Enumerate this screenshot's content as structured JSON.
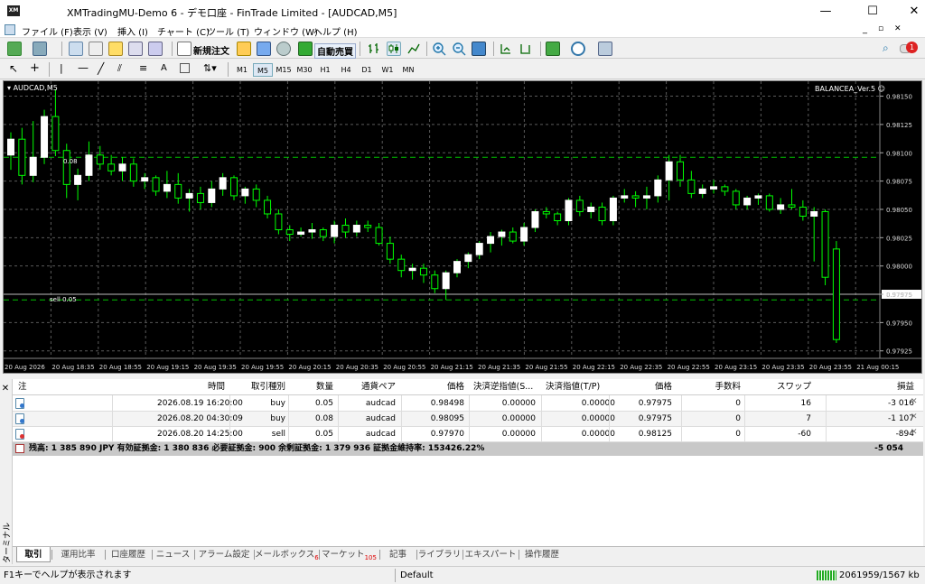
{
  "window": {
    "title": "XMTradingMU-Demo 6 - デモ口座 - FinTrade Limited - [AUDCAD,M5]",
    "logo": "XM",
    "minimize": "—",
    "maximize": "☐",
    "close": "✕"
  },
  "menu": [
    "ファイル (F)",
    "表示 (V)",
    "挿入 (I)",
    "チャート (C)",
    "ツール (T)",
    "ウィンドウ (W)",
    "ヘルプ (H)"
  ],
  "toolbar": {
    "new_order": "新規注文",
    "auto_trade": "自動売買",
    "notif_count": "1"
  },
  "timeframes": [
    "M1",
    "M5",
    "M15",
    "M30",
    "H1",
    "H4",
    "D1",
    "W1",
    "MN"
  ],
  "active_timeframe": "M5",
  "chart": {
    "symbol": "AUDCAD,M5",
    "ea": "BALANCEA_Ver.5 ☺",
    "price_labels": [
      "0.98150",
      "0.98125",
      "0.98100",
      "0.98075",
      "0.98050",
      "0.98025",
      "0.98000",
      "0.97975",
      "0.97950",
      "0.97925"
    ],
    "current_price": "0.97975",
    "time_labels": [
      "20 Aug 2026",
      "20 Aug 18:35",
      "20 Aug 18:55",
      "20 Aug 19:15",
      "20 Aug 19:35",
      "20 Aug 19:55",
      "20 Aug 20:15",
      "20 Aug 20:35",
      "20 Aug 20:55",
      "20 Aug 21:15",
      "20 Aug 21:35",
      "20 Aug 21:55",
      "20 Aug 22:15",
      "20 Aug 22:35",
      "20 Aug 22:55",
      "20 Aug 23:15",
      "20 Aug 23:35",
      "20 Aug 23:55",
      "21 Aug 00:15"
    ],
    "line_label_upper": "0.08",
    "line_label_sell": "sell 0.05",
    "colors": {
      "bull": "#ffffff",
      "bear": "#000000",
      "wick": "#00ff00",
      "grid": "#5a5a5a",
      "levels": "#00c000"
    }
  },
  "chart_data": {
    "type": "candlestick",
    "ylim": [
      0.9792,
      0.9816
    ],
    "candles": [
      [
        0.98098,
        0.98118,
        0.98085,
        0.98112
      ],
      [
        0.98112,
        0.98122,
        0.98072,
        0.9808
      ],
      [
        0.9808,
        0.98128,
        0.98074,
        0.98096
      ],
      [
        0.98096,
        0.98138,
        0.9809,
        0.98132
      ],
      [
        0.98132,
        0.98156,
        0.98097,
        0.98102
      ],
      [
        0.98102,
        0.98108,
        0.9806,
        0.98072
      ],
      [
        0.98072,
        0.98086,
        0.98058,
        0.9808
      ],
      [
        0.9808,
        0.9811,
        0.98075,
        0.98098
      ],
      [
        0.98098,
        0.98106,
        0.98085,
        0.9809
      ],
      [
        0.9809,
        0.98098,
        0.9808,
        0.98084
      ],
      [
        0.98084,
        0.98096,
        0.98075,
        0.9809
      ],
      [
        0.9809,
        0.98095,
        0.9807,
        0.98075
      ],
      [
        0.98075,
        0.98082,
        0.98068,
        0.98078
      ],
      [
        0.98078,
        0.9808,
        0.98062,
        0.98066
      ],
      [
        0.98066,
        0.98084,
        0.9806,
        0.98072
      ],
      [
        0.98072,
        0.98082,
        0.98055,
        0.9806
      ],
      [
        0.9806,
        0.98068,
        0.98048,
        0.98064
      ],
      [
        0.98064,
        0.9807,
        0.9805,
        0.98056
      ],
      [
        0.98056,
        0.98075,
        0.98052,
        0.98068
      ],
      [
        0.98068,
        0.98082,
        0.98062,
        0.98078
      ],
      [
        0.98078,
        0.9808,
        0.98058,
        0.98062
      ],
      [
        0.98062,
        0.9807,
        0.98055,
        0.98068
      ],
      [
        0.98068,
        0.98072,
        0.98052,
        0.98058
      ],
      [
        0.98058,
        0.98062,
        0.98042,
        0.98046
      ],
      [
        0.98046,
        0.9805,
        0.98028,
        0.98032
      ],
      [
        0.98032,
        0.98036,
        0.98022,
        0.98028
      ],
      [
        0.98028,
        0.98034,
        0.98026,
        0.9803
      ],
      [
        0.9803,
        0.98038,
        0.98024,
        0.98032
      ],
      [
        0.98032,
        0.98034,
        0.98022,
        0.98026
      ],
      [
        0.98026,
        0.9804,
        0.9802,
        0.98036
      ],
      [
        0.98036,
        0.98042,
        0.98025,
        0.9803
      ],
      [
        0.9803,
        0.9804,
        0.98026,
        0.98036
      ],
      [
        0.98036,
        0.9804,
        0.9803,
        0.98034
      ],
      [
        0.98034,
        0.98038,
        0.98018,
        0.9802
      ],
      [
        0.9802,
        0.98026,
        0.98002,
        0.98006
      ],
      [
        0.98006,
        0.9801,
        0.9799,
        0.97996
      ],
      [
        0.97996,
        0.98002,
        0.97988,
        0.97998
      ],
      [
        0.97998,
        0.98002,
        0.97985,
        0.97992
      ],
      [
        0.97992,
        0.97996,
        0.97976,
        0.9798
      ],
      [
        0.9798,
        0.97996,
        0.9797,
        0.97994
      ],
      [
        0.97994,
        0.98006,
        0.9799,
        0.98004
      ],
      [
        0.98004,
        0.98012,
        0.97998,
        0.9801
      ],
      [
        0.9801,
        0.98022,
        0.98006,
        0.9802
      ],
      [
        0.9802,
        0.9803,
        0.98012,
        0.98026
      ],
      [
        0.98026,
        0.98032,
        0.98018,
        0.9803
      ],
      [
        0.9803,
        0.98034,
        0.9802,
        0.98022
      ],
      [
        0.98022,
        0.98038,
        0.98018,
        0.98034
      ],
      [
        0.98034,
        0.9805,
        0.9803,
        0.98048
      ],
      [
        0.98048,
        0.98052,
        0.98042,
        0.98046
      ],
      [
        0.98046,
        0.98048,
        0.98036,
        0.9804
      ],
      [
        0.9804,
        0.9806,
        0.98036,
        0.98058
      ],
      [
        0.98058,
        0.98062,
        0.98044,
        0.98048
      ],
      [
        0.98048,
        0.98056,
        0.98042,
        0.98052
      ],
      [
        0.98052,
        0.98056,
        0.98036,
        0.9804
      ],
      [
        0.9804,
        0.98062,
        0.98036,
        0.9806
      ],
      [
        0.9806,
        0.98068,
        0.98056,
        0.98062
      ],
      [
        0.98062,
        0.98066,
        0.98052,
        0.9806
      ],
      [
        0.9806,
        0.9807,
        0.9805,
        0.98062
      ],
      [
        0.98062,
        0.9808,
        0.98056,
        0.98076
      ],
      [
        0.98076,
        0.98098,
        0.98058,
        0.98092
      ],
      [
        0.98092,
        0.98098,
        0.9807,
        0.98076
      ],
      [
        0.98076,
        0.98084,
        0.9806,
        0.98064
      ],
      [
        0.98064,
        0.98072,
        0.9806,
        0.98068
      ],
      [
        0.98068,
        0.98076,
        0.98064,
        0.9807
      ],
      [
        0.9807,
        0.98072,
        0.98062,
        0.98066
      ],
      [
        0.98066,
        0.98068,
        0.9805,
        0.98054
      ],
      [
        0.98054,
        0.98062,
        0.9805,
        0.9806
      ],
      [
        0.9806,
        0.98064,
        0.98054,
        0.98062
      ],
      [
        0.98062,
        0.98064,
        0.98048,
        0.9805
      ],
      [
        0.9805,
        0.9806,
        0.98046,
        0.98054
      ],
      [
        0.98054,
        0.98068,
        0.9805,
        0.98052
      ],
      [
        0.98052,
        0.98058,
        0.9804,
        0.98044
      ],
      [
        0.98044,
        0.98052,
        0.98004,
        0.98048
      ],
      [
        0.98048,
        0.9805,
        0.97983,
        0.9799
      ],
      [
        0.98015,
        0.98022,
        0.97932,
        0.97935
      ]
    ]
  },
  "terminal": {
    "headers": [
      "注",
      "時間",
      "取引種別",
      "数量",
      "通貨ペア",
      "価格",
      "決済逆指値(S...",
      "決済指値(T/P)",
      "価格",
      "手数料",
      "スワップ",
      "損益"
    ],
    "rows": [
      [
        "2026.08.19 16:20:00",
        "buy",
        "0.05",
        "audcad",
        "0.98498",
        "0.00000",
        "0.00000",
        "0.97975",
        "0",
        "16",
        "-3 016"
      ],
      [
        "2026.08.20 04:30:09",
        "buy",
        "0.08",
        "audcad",
        "0.98095",
        "0.00000",
        "0.00000",
        "0.97975",
        "0",
        "7",
        "-1 107"
      ],
      [
        "2026.08.20 14:25:00",
        "sell",
        "0.05",
        "audcad",
        "0.97970",
        "0.00000",
        "0.00000",
        "0.98125",
        "0",
        "-60",
        "-894"
      ]
    ],
    "balance_text": "残高: 1 385 890 JPY  有効証拠金: 1 380 836  必要証拠金: 900  余剰証拠金: 1 379 936  証拠金維持率: 153426.22%",
    "balance_total": "-5 054",
    "side_label": "ターミナル"
  },
  "tabs": [
    {
      "label": "取引"
    },
    {
      "label": "運用比率"
    },
    {
      "label": "口座履歴"
    },
    {
      "label": "ニュース"
    },
    {
      "label": "アラーム設定"
    },
    {
      "label": "メールボックス",
      "badge": "6"
    },
    {
      "label": "マーケット",
      "badge": "105"
    },
    {
      "label": "記事"
    },
    {
      "label": "ライブラリ"
    },
    {
      "label": "エキスパート"
    },
    {
      "label": "操作履歴"
    }
  ],
  "status": {
    "help": "F1キーでヘルプが表示されます",
    "profile": "Default",
    "traffic": "2061959/1567 kb"
  }
}
